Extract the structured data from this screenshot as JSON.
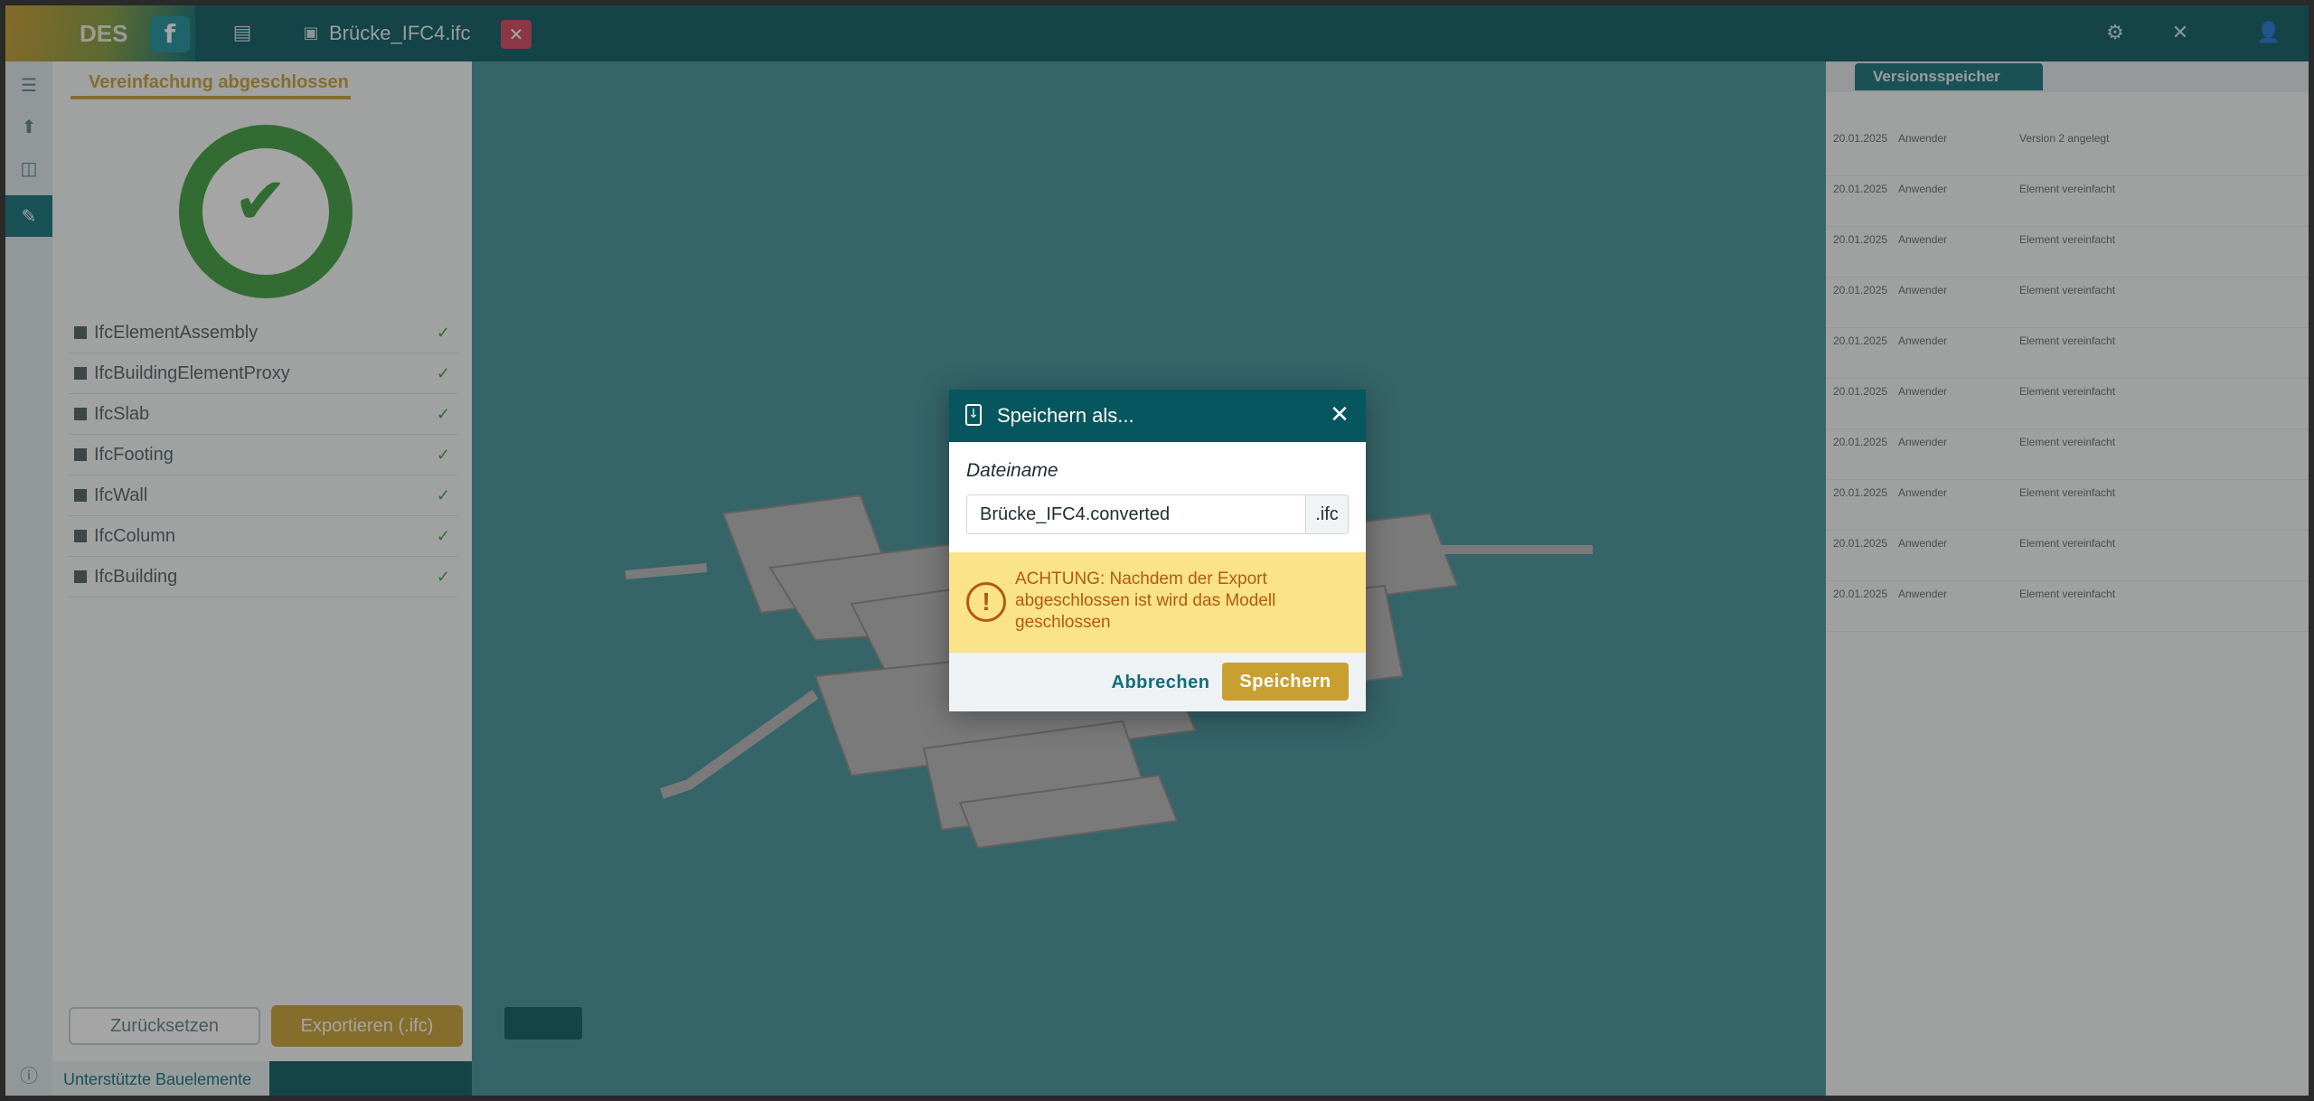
{
  "app": {
    "logo_letter": "f",
    "brand_text": "DES",
    "file_title": "Brücke_IFC4.ifc"
  },
  "left_panel": {
    "tab_label": "Vereinfachung abgeschlossen",
    "items": [
      {
        "label": "IfcElementAssembly"
      },
      {
        "label": "IfcBuildingElementProxy"
      },
      {
        "label": "IfcSlab"
      },
      {
        "label": "IfcFooting"
      },
      {
        "label": "IfcWall"
      },
      {
        "label": "IfcColumn"
      },
      {
        "label": "IfcBuilding"
      }
    ],
    "reset_button": "Zurücksetzen",
    "export_button": "Exportieren (.ifc)",
    "footer_text": "Unterstützte Bauelemente"
  },
  "right_panel": {
    "tab_label": "Versionsspeicher",
    "rows": [
      {
        "time": "20.01.2025",
        "user": "Anwender",
        "text": "Version 2 angelegt"
      },
      {
        "time": "20.01.2025",
        "user": "Anwender",
        "text": "Element vereinfacht"
      },
      {
        "time": "20.01.2025",
        "user": "Anwender",
        "text": "Element vereinfacht"
      },
      {
        "time": "20.01.2025",
        "user": "Anwender",
        "text": "Element vereinfacht"
      },
      {
        "time": "20.01.2025",
        "user": "Anwender",
        "text": "Element vereinfacht"
      },
      {
        "time": "20.01.2025",
        "user": "Anwender",
        "text": "Element vereinfacht"
      },
      {
        "time": "20.01.2025",
        "user": "Anwender",
        "text": "Element vereinfacht"
      },
      {
        "time": "20.01.2025",
        "user": "Anwender",
        "text": "Element vereinfacht"
      },
      {
        "time": "20.01.2025",
        "user": "Anwender",
        "text": "Element vereinfacht"
      },
      {
        "time": "20.01.2025",
        "user": "Anwender",
        "text": "Element vereinfacht"
      }
    ]
  },
  "dialog": {
    "title": "Speichern als...",
    "field_label": "Dateiname",
    "filename_value": "Brücke_IFC4.converted",
    "extension": ".ifc",
    "warning_text": "ACHTUNG: Nachdem der Export abgeschlossen ist wird das Modell geschlossen",
    "cancel_label": "Abbrechen",
    "save_label": "Speichern"
  },
  "colors": {
    "header": "#06565f",
    "accent_gold": "#c9a030",
    "teal": "#0f6e79",
    "viewport_bg": "#3f8f98",
    "warning_bg": "#fbe38a",
    "warning_text": "#b45a10",
    "success_green": "#3c9e3c"
  }
}
